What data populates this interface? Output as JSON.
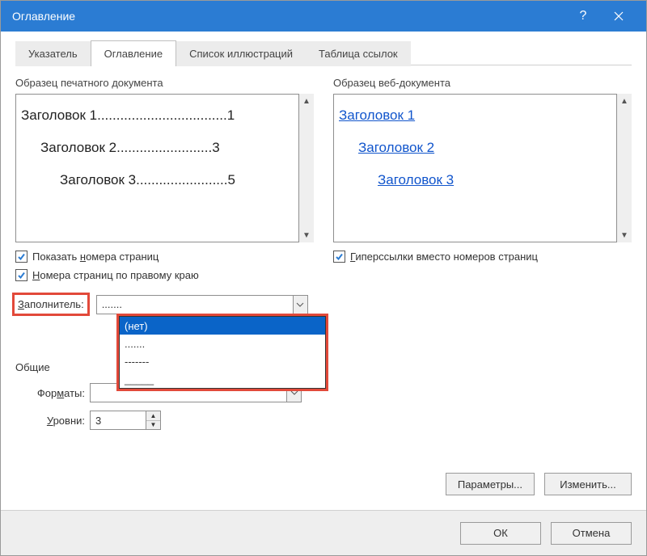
{
  "window": {
    "title": "Оглавление"
  },
  "tabs": {
    "index": "Указатель",
    "toc": "Оглавление",
    "illustrations": "Список иллюстраций",
    "authorities": "Таблица ссылок"
  },
  "preview": {
    "print_label": "Образец печатного документа",
    "web_label": "Образец веб-документа",
    "print": [
      {
        "text": "Заголовок 1",
        "leader": "..................................",
        "page": "1",
        "indent": 0
      },
      {
        "text": "Заголовок 2",
        "leader": ".........................",
        "page": "3",
        "indent": 1
      },
      {
        "text": "Заголовок 3",
        "leader": "........................",
        "page": "5",
        "indent": 2
      }
    ],
    "web": [
      {
        "text": "Заголовок 1",
        "indent": 0
      },
      {
        "text": "Заголовок 2",
        "indent": 1
      },
      {
        "text": "Заголовок 3",
        "indent": 2
      }
    ]
  },
  "checkboxes": {
    "show_page_numbers_pre": "Показать ",
    "show_page_numbers_u": "н",
    "show_page_numbers_post": "омера страниц",
    "right_align_u": "Н",
    "right_align_post": "омера страниц по правому краю",
    "hyperlinks_u": "Г",
    "hyperlinks_post": "иперссылки вместо номеров страниц"
  },
  "leader": {
    "label_u": "З",
    "label_post": "аполнитель:",
    "value": ".......",
    "options": [
      "(нет)",
      ".......",
      "-------",
      "_____"
    ]
  },
  "section": {
    "general": "Общие"
  },
  "formats": {
    "label_pre": "Фор",
    "label_u": "м",
    "label_post": "аты:",
    "value": ""
  },
  "levels": {
    "label_u": "У",
    "label_post": "ровни:",
    "value": "3"
  },
  "buttons": {
    "options": "Параметры...",
    "modify": "Изменить...",
    "ok": "ОК",
    "cancel": "Отмена"
  }
}
